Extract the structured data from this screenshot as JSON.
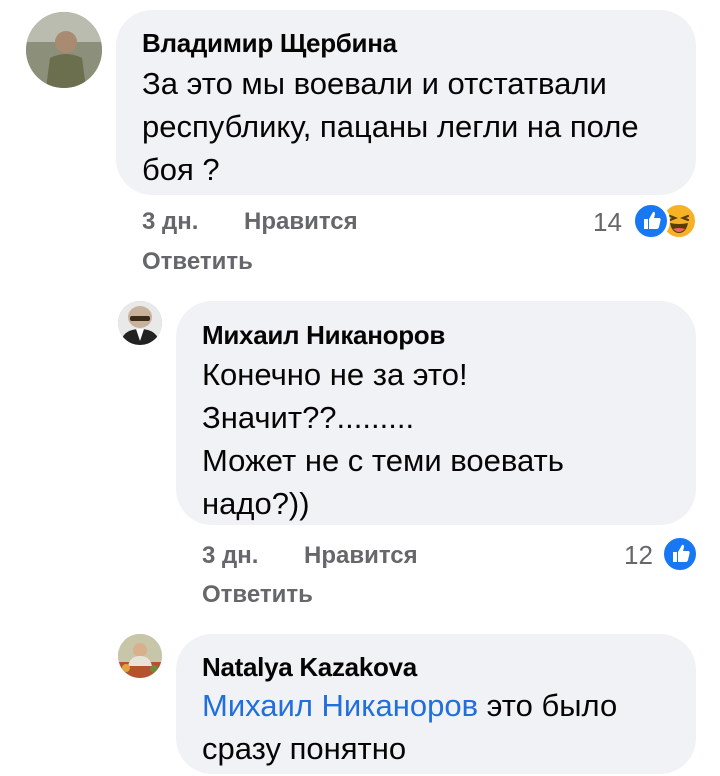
{
  "comments": [
    {
      "author": "Владимир Щербина",
      "lines": [
        "За это мы воевали и отстатвали",
        "республику, пацаны легли на поле",
        "боя ?"
      ],
      "time": "3 дн.",
      "like_label": "Нравится",
      "reply_label": "Ответить",
      "reaction_count": "14",
      "reactions": [
        "like-icon",
        "haha-icon"
      ]
    },
    {
      "author": "Михаил Никаноров",
      "lines": [
        "Конечно не за это!",
        "Значит??.........",
        "Может не с теми воевать",
        "надо?))"
      ],
      "time": "3 дн.",
      "like_label": "Нравится",
      "reply_label": "Ответить",
      "reaction_count": "12",
      "reactions": [
        "like-icon"
      ]
    },
    {
      "author": "Natalya Kazakova",
      "mention": "Михаил Никаноров",
      "line1_rest": " это было",
      "line2": "сразу понятно"
    }
  ],
  "colors": {
    "bubble": "#f0f2f5",
    "meta_text": "#65676b",
    "mention": "#216fdb",
    "like_blue": "#1877f2",
    "haha_yellow": "#f7b125"
  }
}
